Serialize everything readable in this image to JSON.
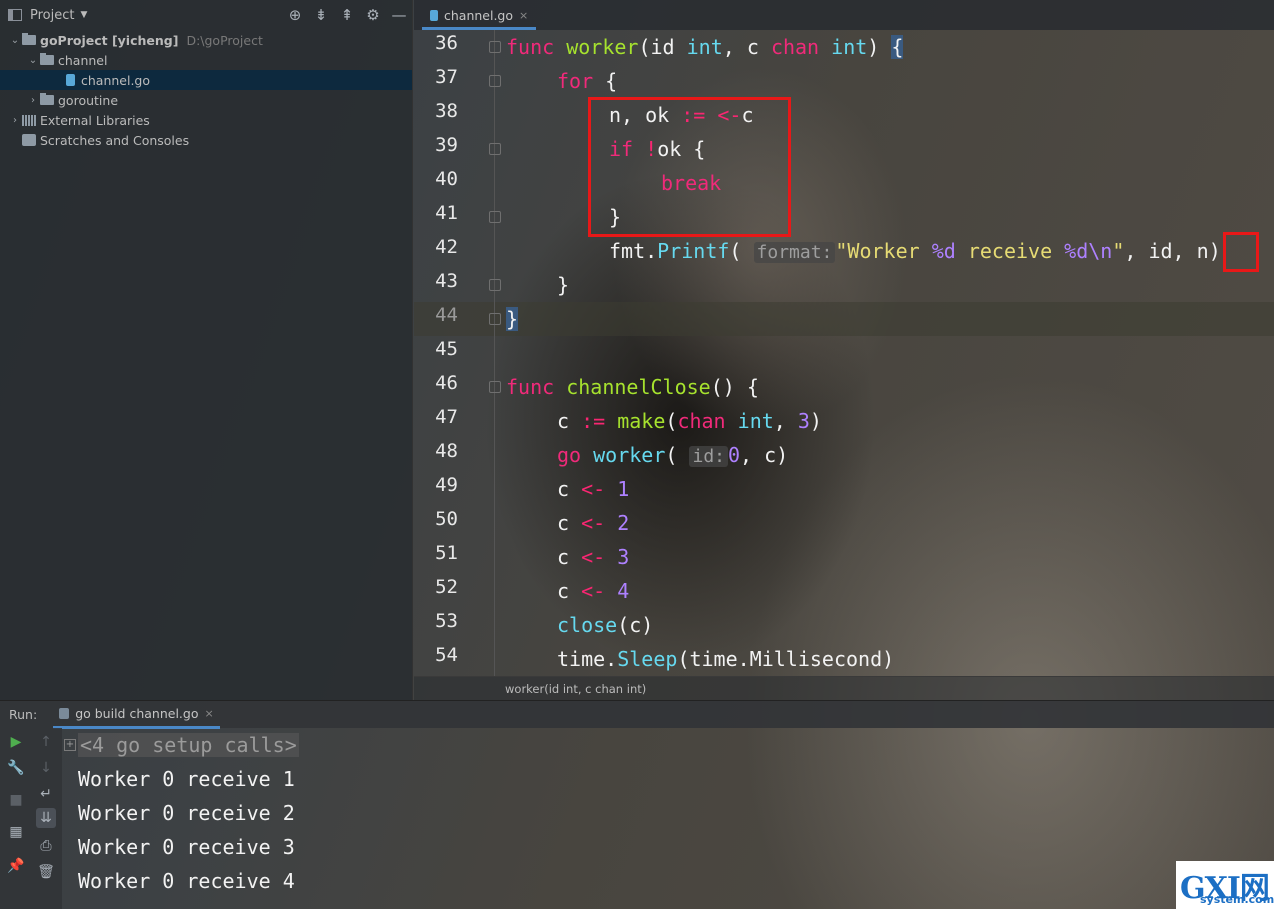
{
  "project_panel": {
    "title": "Project",
    "tree": {
      "root_name": "goProject [yicheng]",
      "root_path": "D:\\goProject",
      "channel_folder": "channel",
      "channel_file": "channel.go",
      "goroutine_folder": "goroutine",
      "external_libraries": "External Libraries",
      "scratches": "Scratches and Consoles"
    }
  },
  "editor": {
    "tab_label": "channel.go",
    "line_numbers": [
      "36",
      "37",
      "38",
      "39",
      "40",
      "41",
      "42",
      "43",
      "44",
      "45",
      "46",
      "47",
      "48",
      "49",
      "50",
      "51",
      "52",
      "53",
      "54"
    ],
    "code": {
      "l36": {
        "kw": "func",
        "name": "worker",
        "args": "(id ",
        "t1": "int",
        "mid": ", c ",
        "kw2": "chan",
        "sp": " ",
        "t2": "int",
        "end": ") ",
        "brace": "{"
      },
      "l37": {
        "kw": "for",
        "rest": " {"
      },
      "l38": {
        "a": "n, ok ",
        "op": ":= <-",
        "b": "c"
      },
      "l39": {
        "kw": "if",
        "op": " !",
        "b": "ok {"
      },
      "l40": {
        "kw": "break"
      },
      "l41": {
        "a": "}"
      },
      "l42": {
        "pkg": "fmt.",
        "fn": "Printf",
        "open": "(",
        "hint": "format:",
        "str1": "\"Worker ",
        "fmt1": "%d",
        "str2": " receive ",
        "fmt2": "%d\\n",
        "str3": "\"",
        "rest": ", id, ",
        "n": "n",
        "close": ")"
      },
      "l43": {
        "a": "}"
      },
      "l44": {
        "a": "}"
      },
      "l46": {
        "kw": "func",
        "fn": "channelClose",
        "rest": "() {"
      },
      "l47": {
        "a": "c ",
        "op": ":= ",
        "fn": "make",
        "open": "(",
        "kw": "chan",
        "sp": " ",
        "ty": "int",
        "comma": ", ",
        "num": "3",
        "close": ")"
      },
      "l48": {
        "kw": "go",
        "sp": " ",
        "fn": "worker",
        "open": "(",
        "hint": "id:",
        "num": "0",
        "rest": ", c)"
      },
      "l49": {
        "a": "c ",
        "op": "<- ",
        "num": "1"
      },
      "l50": {
        "a": "c ",
        "op": "<- ",
        "num": "2"
      },
      "l51": {
        "a": "c ",
        "op": "<- ",
        "num": "3"
      },
      "l52": {
        "a": "c ",
        "op": "<- ",
        "num": "4"
      },
      "l53": {
        "fn": "close",
        "rest": "(c)"
      },
      "l54": {
        "a": "time.",
        "fn": "Sleep",
        "rest": "(time.Millisecond)"
      }
    },
    "breadcrumb": "worker(id int, c chan int)"
  },
  "run_panel": {
    "label": "Run:",
    "tab_label": "go build channel.go",
    "setup_calls": "<4 go setup calls>",
    "output": [
      "Worker 0 receive 1",
      "Worker 0 receive 2",
      "Worker 0 receive 3",
      "Worker 0 receive 4"
    ]
  },
  "watermark": {
    "main": "GXI网",
    "sub": "system.com"
  },
  "colors": {
    "keyword": "#f02a7a",
    "function": "#a6e22e",
    "type": "#66d9ef",
    "number": "#ae81ff",
    "string": "#e6db74",
    "annotation_box": "#e81818",
    "selection": "#0d293e"
  }
}
